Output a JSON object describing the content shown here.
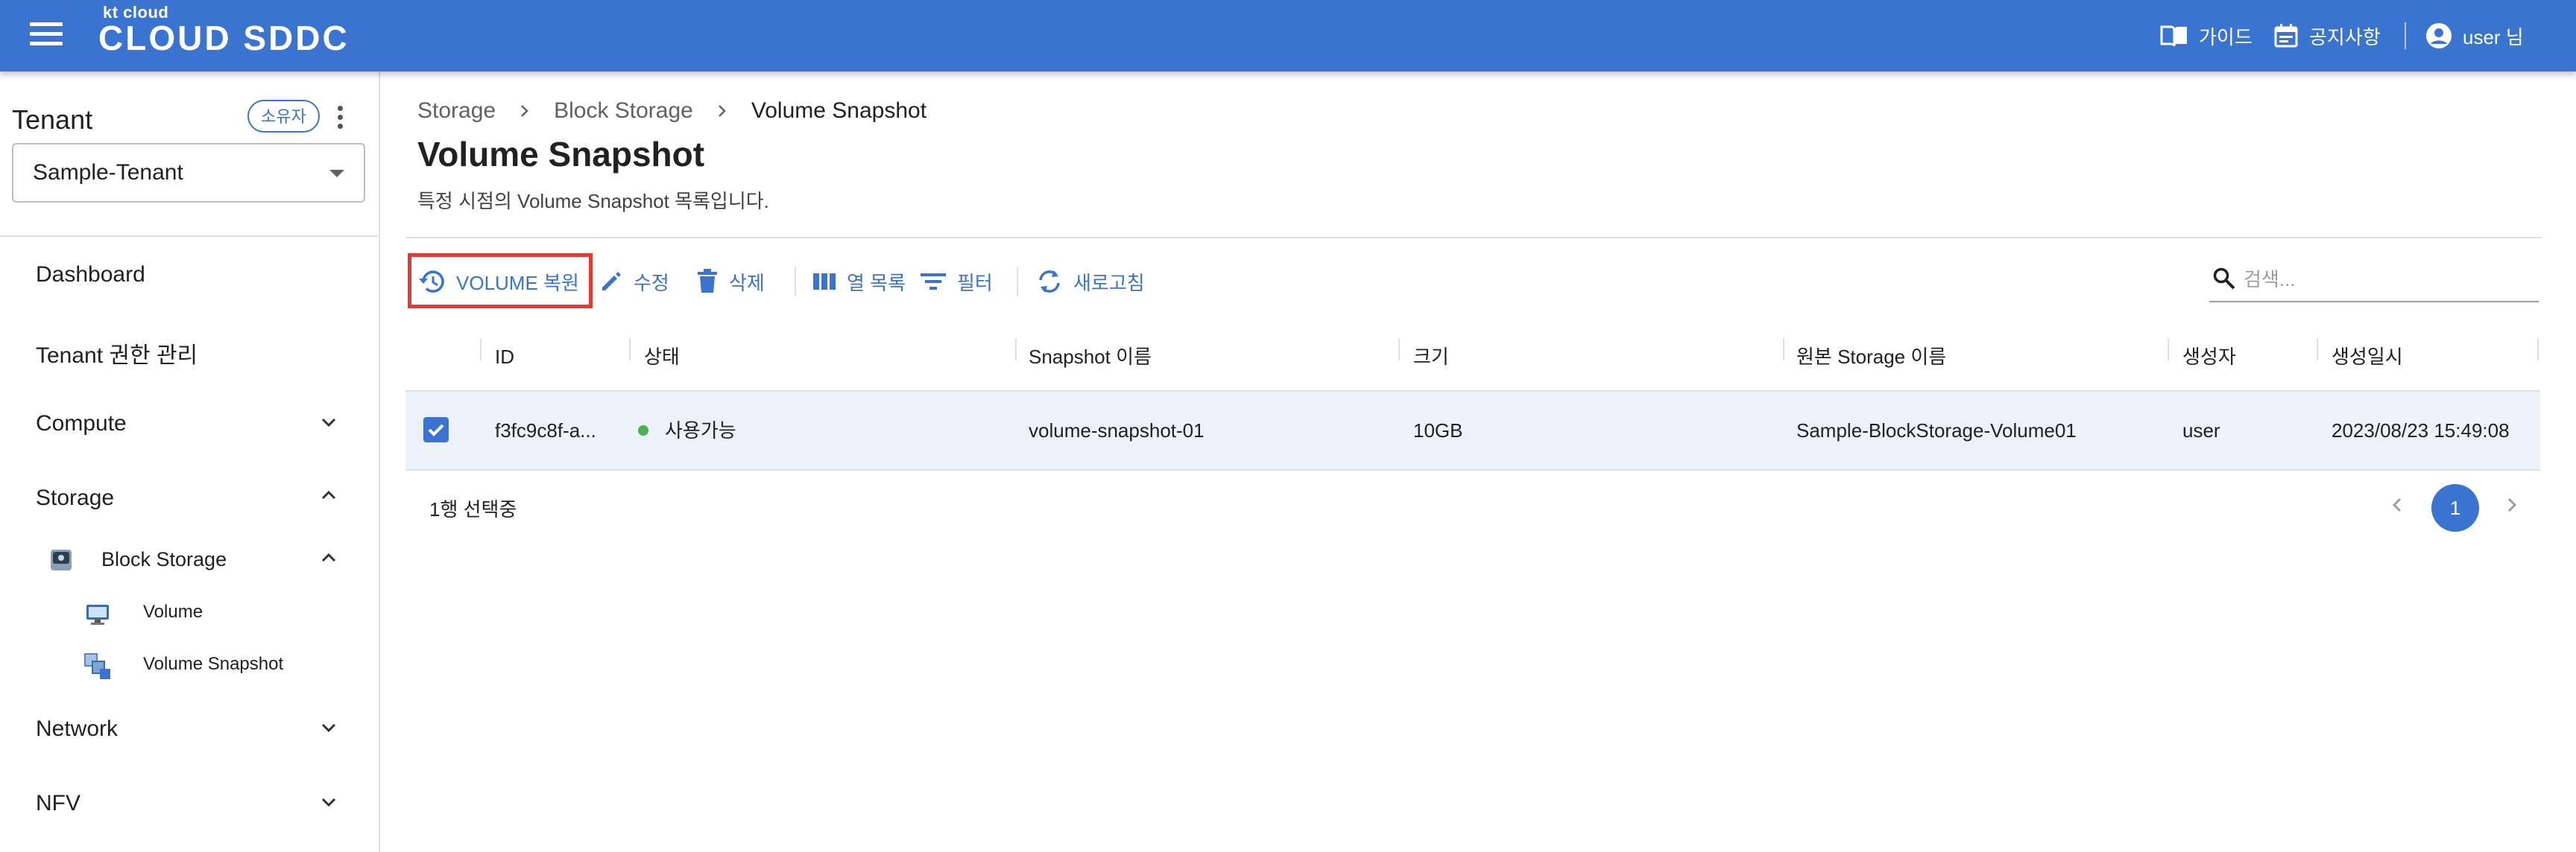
{
  "header": {
    "brand_small": "kt cloud",
    "brand_main": "CLOUD SDDC",
    "guide_label": "가이드",
    "notice_label": "공지사항",
    "user_label": "user 님"
  },
  "sidebar": {
    "tenant_title": "Tenant",
    "owner_badge": "소유자",
    "tenant_selected": "Sample-Tenant",
    "menu": {
      "dashboard": "Dashboard",
      "tenant_auth": "Tenant 권한 관리",
      "compute": "Compute",
      "storage": "Storage",
      "block_storage": "Block Storage",
      "volume": "Volume",
      "volume_snapshot": "Volume Snapshot",
      "network": "Network",
      "nfv": "NFV"
    }
  },
  "breadcrumb": {
    "items": [
      "Storage",
      "Block Storage",
      "Volume Snapshot"
    ]
  },
  "page": {
    "title": "Volume Snapshot",
    "description": "특정 시점의 Volume Snapshot 목록입니다."
  },
  "toolbar": {
    "restore": "VOLUME 복원",
    "edit": "수정",
    "delete": "삭제",
    "columns": "열 목록",
    "filter": "필터",
    "refresh": "새로고침",
    "search_placeholder": "검색..."
  },
  "table": {
    "headers": [
      "ID",
      "상태",
      "Snapshot 이름",
      "크기",
      "원본 Storage 이름",
      "생성자",
      "생성일시"
    ],
    "rows": [
      {
        "id": "f3fc9c8f-a...",
        "status": "사용가능",
        "snapshot_name": "volume-snapshot-01",
        "size": "10GB",
        "source_storage": "Sample-BlockStorage-Volume01",
        "creator": "user",
        "created_at": "2023/08/23 15:49:08",
        "selected": true
      }
    ]
  },
  "footer": {
    "selected_count": "1행 선택중",
    "current_page": "1"
  },
  "colors": {
    "primary": "#3a73d0",
    "status_available": "#4caf50",
    "highlight_box": "#e53935",
    "selected_row": "#edf2fa"
  }
}
